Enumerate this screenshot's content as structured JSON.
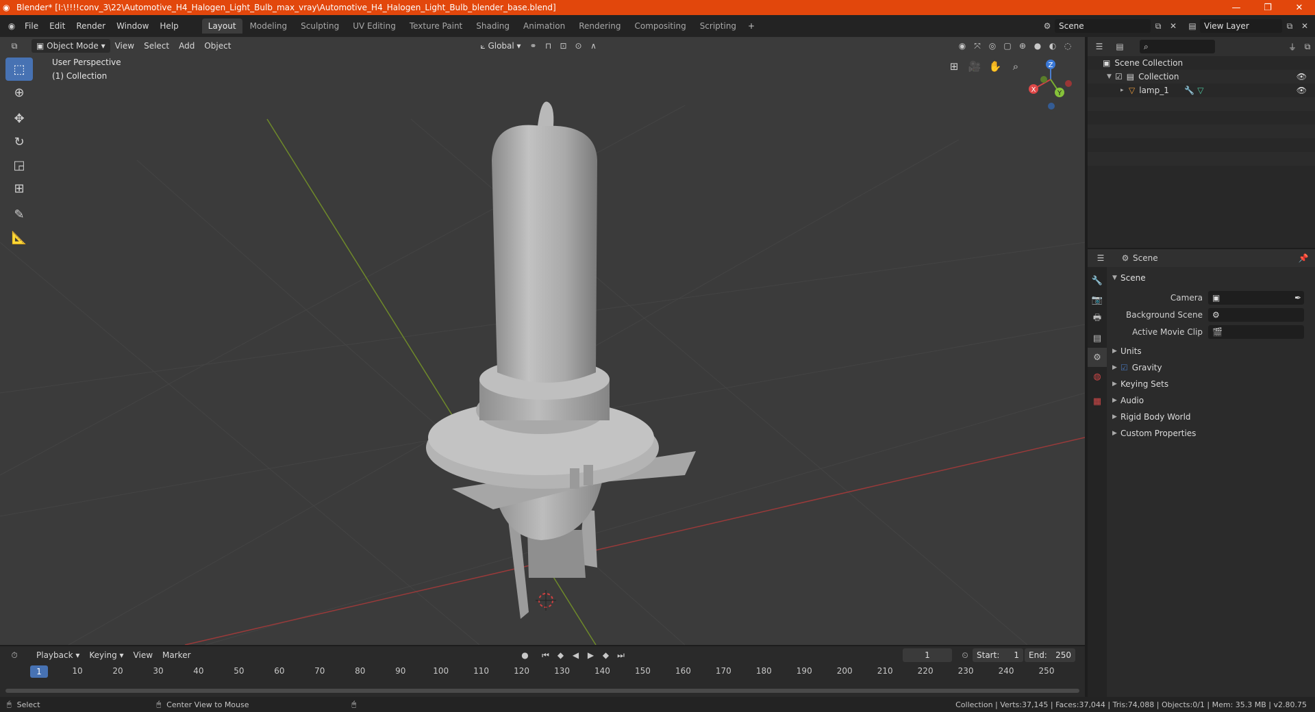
{
  "titlebar": {
    "title": "Blender* [I:\\!!!!conv_3\\22\\Automotive_H4_Halogen_Light_Bulb_max_vray\\Automotive_H4_Halogen_Light_Bulb_blender_base.blend]",
    "accent": "#e2470c"
  },
  "menu": {
    "file": "File",
    "edit": "Edit",
    "render": "Render",
    "window": "Window",
    "help": "Help"
  },
  "workspaces": [
    "Layout",
    "Modeling",
    "Sculpting",
    "UV Editing",
    "Texture Paint",
    "Shading",
    "Animation",
    "Rendering",
    "Compositing",
    "Scripting"
  ],
  "scene_field": "Scene",
  "view_layer_field": "View Layer",
  "viewport": {
    "mode": "Object Mode",
    "menus": [
      "View",
      "Select",
      "Add",
      "Object"
    ],
    "transform_orientation": "Global",
    "overlay_line1": "User Perspective",
    "overlay_line2": "(1) Collection",
    "gizmo": {
      "x": "X",
      "y": "Y",
      "z": "Z"
    }
  },
  "outliner": {
    "root": "Scene Collection",
    "collection": "Collection",
    "object": "lamp_1"
  },
  "properties": {
    "header_title": "Scene",
    "panel_title": "Scene",
    "camera_label": "Camera",
    "background_scene_label": "Background Scene",
    "active_movie_clip_label": "Active Movie Clip",
    "subpanels": [
      "Units",
      "Gravity",
      "Keying Sets",
      "Audio",
      "Rigid Body World",
      "Custom Properties"
    ]
  },
  "timeline": {
    "menus": [
      "Playback",
      "Keying",
      "View",
      "Marker"
    ],
    "current_frame": "1",
    "start_label": "Start:",
    "start_value": "1",
    "end_label": "End:",
    "end_value": "250",
    "ticks": [
      "1",
      "10",
      "20",
      "30",
      "40",
      "50",
      "60",
      "70",
      "80",
      "90",
      "100",
      "110",
      "120",
      "130",
      "140",
      "150",
      "160",
      "170",
      "180",
      "190",
      "200",
      "210",
      "220",
      "230",
      "240",
      "250"
    ]
  },
  "statusbar": {
    "select": "Select",
    "center_view": "Center View to Mouse",
    "stats": "Collection | Verts:37,145 | Faces:37,044 | Tris:74,088 | Objects:0/1 | Mem: 35.3 MB | v2.80.75"
  }
}
